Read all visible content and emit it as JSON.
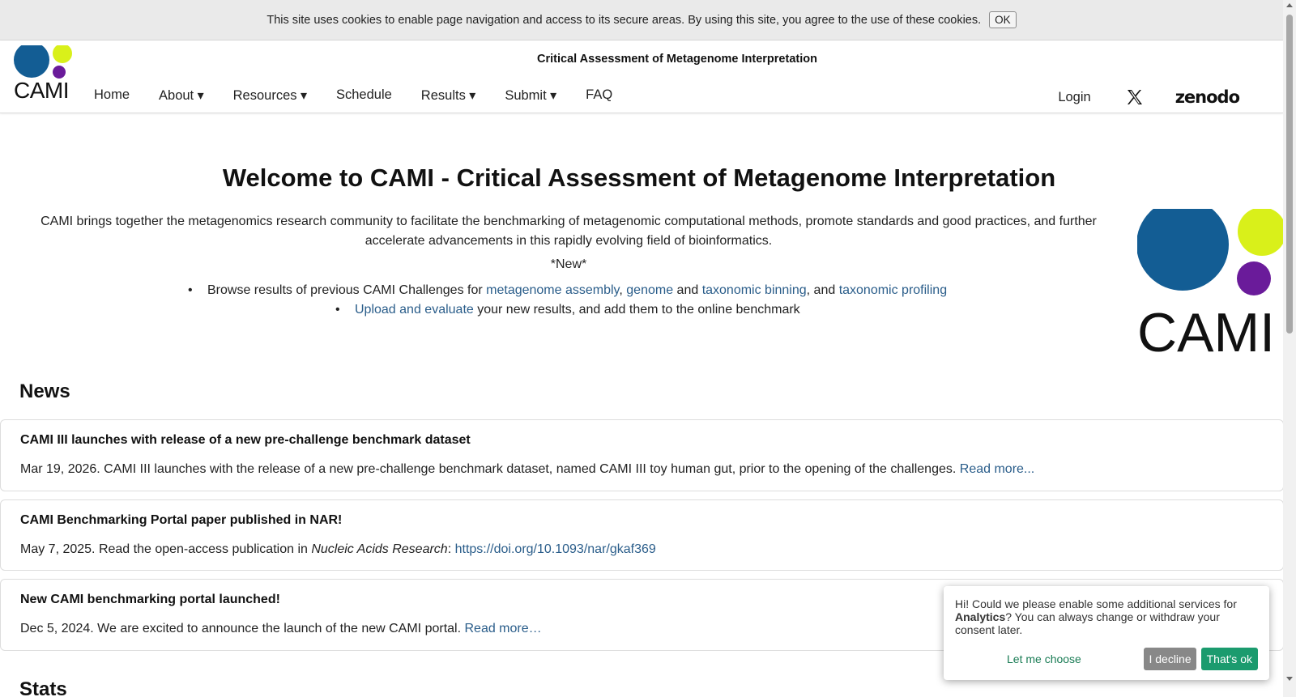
{
  "cookie_bar": {
    "text": "This site uses cookies to enable page navigation and access to its secure areas. By using this site, you agree to the use of these cookies.",
    "ok_label": "OK"
  },
  "header": {
    "logo_text": "CAMI",
    "site_title": "Critical Assessment of Metagenome Interpretation",
    "nav": [
      "Home",
      "About",
      "Resources",
      "Schedule",
      "Results",
      "Submit",
      "FAQ"
    ],
    "login_label": "Login",
    "zenodo_label": "zenodo"
  },
  "main": {
    "welcome": "Welcome to CAMI - Critical Assessment of Metagenome Interpretation",
    "intro": "CAMI brings together the metagenomics research community to facilitate the benchmarking of metagenomic computational methods, promote standards and good practices, and further accelerate advancements in this rapidly evolving field of bioinformatics.",
    "new_label": "*New*",
    "bullet1": {
      "prefix": "Browse results of previous CAMI Challenges for ",
      "link1": "metagenome assembly",
      "sep1": ", ",
      "link2": "genome",
      "sep2": " and ",
      "link3": "taxonomic binning",
      "sep3": ", and ",
      "link4": "taxonomic profiling"
    },
    "bullet2": {
      "link": "Upload and evaluate",
      "suffix": " your new results, and add them to the online benchmark"
    },
    "big_logo_text": "CAMI"
  },
  "news": {
    "title": "News",
    "items": [
      {
        "title": "CAMI III launches with release of a new pre-challenge benchmark dataset",
        "text": "Mar 19, 2026. CAMI III launches with the release of a new pre-challenge benchmark dataset, named CAMI III toy human gut, prior to the opening of the challenges. ",
        "link": "Read more..."
      },
      {
        "title": "CAMI Benchmarking Portal paper published in NAR!",
        "text_prefix": "May 7, 2025. Read the open-access publication in ",
        "journal": "Nucleic Acids Research",
        "colon": ": ",
        "link": "https://doi.org/10.1093/nar/gkaf369"
      },
      {
        "title": "New CAMI benchmarking portal launched!",
        "text": "Dec 5, 2024. We are excited to announce the launch of the new CAMI portal. ",
        "link": "Read more…"
      }
    ]
  },
  "stats": {
    "title": "Stats"
  },
  "consent": {
    "text_prefix": "Hi! Could we please enable some additional services for ",
    "bold": "Analytics",
    "text_suffix": "? You can always change or withdraw your consent later.",
    "choose_label": "Let me choose",
    "decline_label": "I decline",
    "accept_label": "That's ok"
  },
  "colors": {
    "link": "#2a5d8a",
    "logo_blue": "#135d94",
    "logo_yellow": "#d9f01a",
    "logo_purple": "#6a1b9a",
    "accept_green": "#1b9b6e"
  }
}
